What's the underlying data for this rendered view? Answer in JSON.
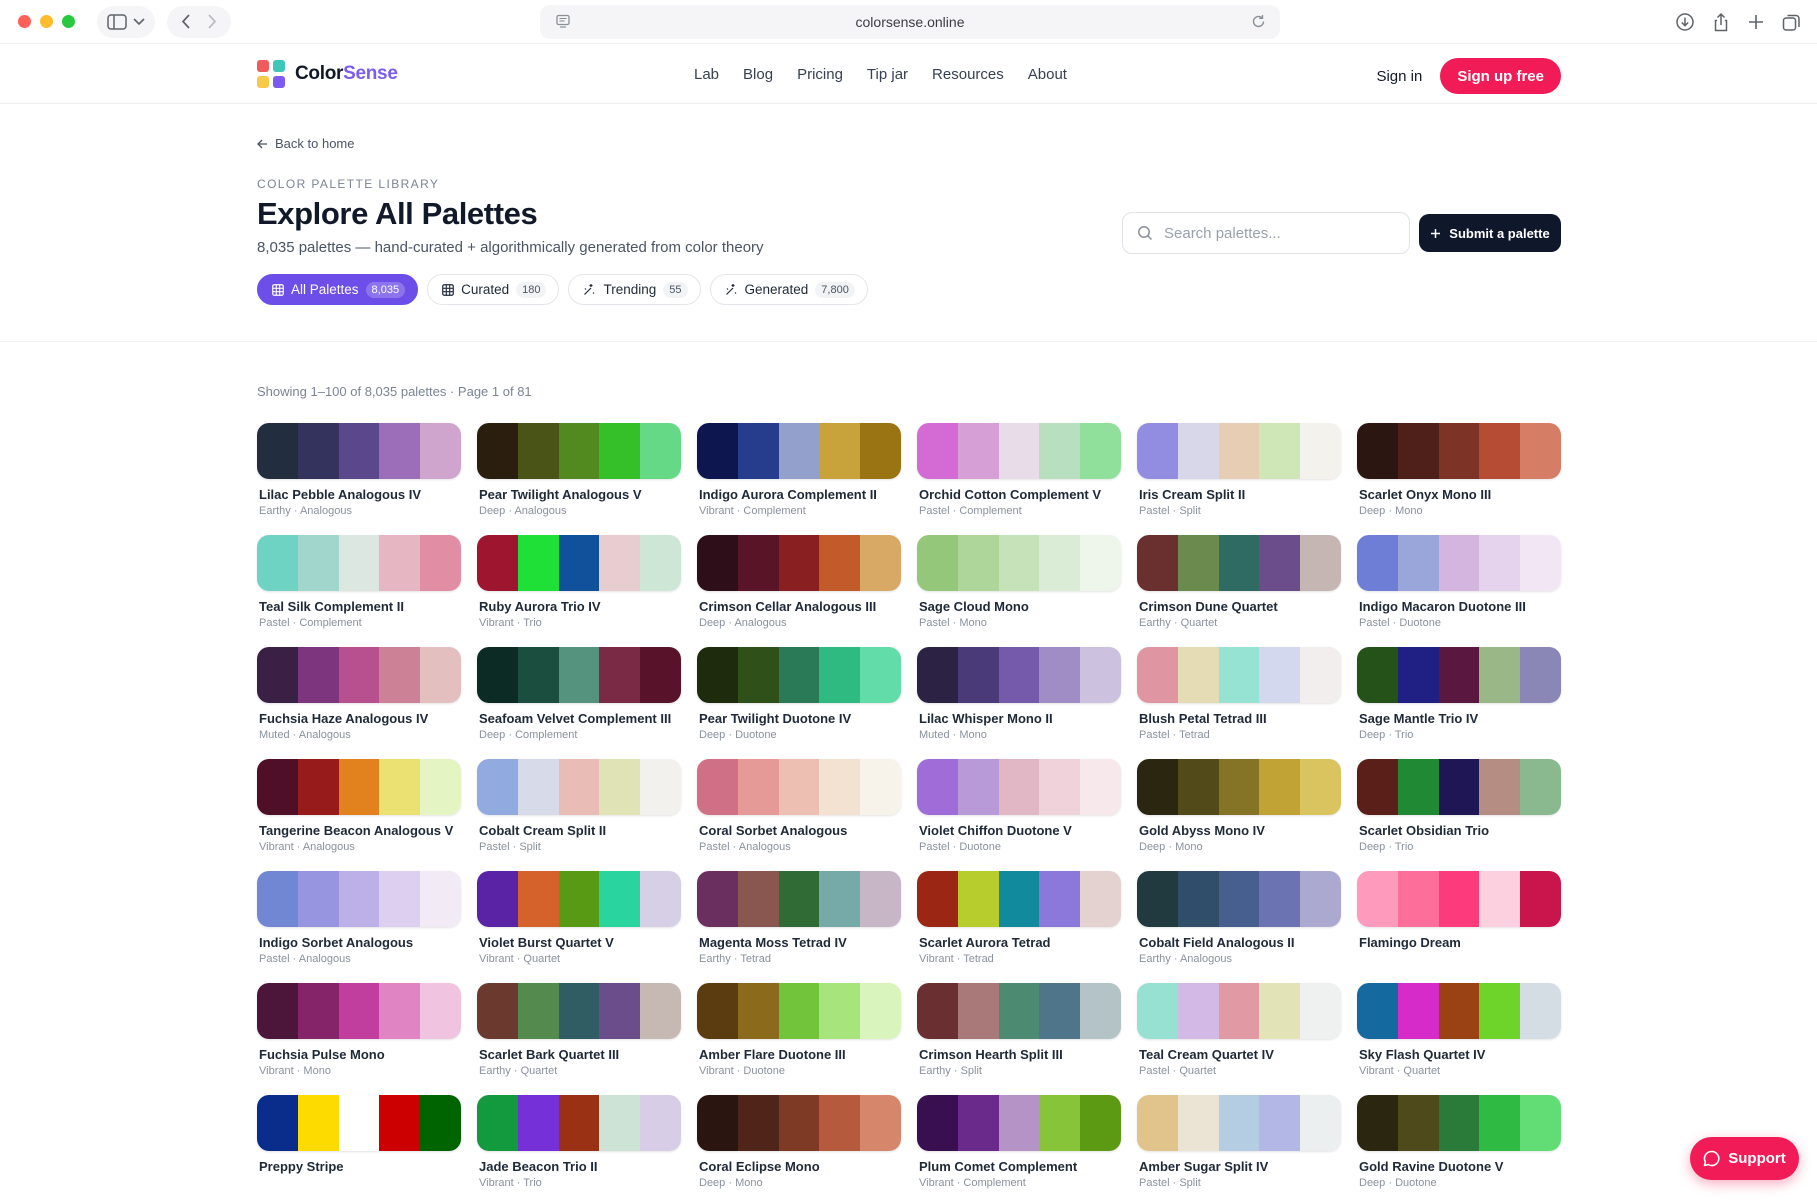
{
  "browser": {
    "url": "colorsense.online"
  },
  "brand": {
    "name_part1": "Color",
    "name_part2": "Sense",
    "logo_colors": [
      "#f25b5b",
      "#3ec6b8",
      "#f7c948",
      "#7c5cf0"
    ]
  },
  "nav": {
    "items": [
      "Lab",
      "Blog",
      "Pricing",
      "Tip jar",
      "Resources",
      "About"
    ],
    "signin": "Sign in",
    "signup": "Sign up free"
  },
  "hero": {
    "back": "Back to home",
    "eyebrow": "COLOR PALETTE LIBRARY",
    "title": "Explore All Palettes",
    "subtitle": "8,035 palettes — hand-curated + algorithmically generated from color theory",
    "search_placeholder": "Search palettes...",
    "submit": "Submit a palette"
  },
  "filters": [
    {
      "label": "All Palettes",
      "count": "8,035",
      "icon": "grid-icon",
      "active": true
    },
    {
      "label": "Curated",
      "count": "180",
      "icon": "grid-icon",
      "active": false
    },
    {
      "label": "Trending",
      "count": "55",
      "icon": "sparkle-icon",
      "active": false
    },
    {
      "label": "Generated",
      "count": "7,800",
      "icon": "sparkle-icon",
      "active": false
    }
  ],
  "results": "Showing 1–100 of 8,035 palettes · Page 1 of 81",
  "palettes": [
    {
      "name": "Lilac Pebble Analogous IV",
      "meta": "Earthy · Analogous",
      "colors": [
        "#222d3d",
        "#33335e",
        "#5b478c",
        "#9c6db8",
        "#d0a5cd"
      ]
    },
    {
      "name": "Pear Twilight Analogous V",
      "meta": "Deep · Analogous",
      "colors": [
        "#2a1f0f",
        "#4a5416",
        "#528a1f",
        "#35c02a",
        "#66d987"
      ]
    },
    {
      "name": "Indigo Aurora Complement II",
      "meta": "Vibrant · Complement",
      "colors": [
        "#0e1650",
        "#263c8c",
        "#94a0cc",
        "#c8a23a",
        "#9a7412"
      ]
    },
    {
      "name": "Orchid Cotton Complement V",
      "meta": "Pastel · Complement",
      "colors": [
        "#d46ad4",
        "#d6a0d6",
        "#e9dce9",
        "#b7dfc0",
        "#90e09c"
      ]
    },
    {
      "name": "Iris Cream Split II",
      "meta": "Pastel · Split",
      "colors": [
        "#928de0",
        "#d8d7ea",
        "#e7cdb4",
        "#cfe7b6",
        "#f3f2ec"
      ]
    },
    {
      "name": "Scarlet Onyx Mono III",
      "meta": "Deep · Mono",
      "colors": [
        "#2b1611",
        "#4e2019",
        "#7d3325",
        "#b74c35",
        "#d67d66"
      ]
    },
    {
      "name": "Teal Silk Complement II",
      "meta": "Pastel · Complement",
      "colors": [
        "#6ed3c3",
        "#a0d6cc",
        "#dce7e2",
        "#e7b6c3",
        "#e18ea4"
      ]
    },
    {
      "name": "Ruby Aurora Trio IV",
      "meta": "Vibrant · Trio",
      "colors": [
        "#9e1530",
        "#1fe037",
        "#11509a",
        "#e7ccd0",
        "#cde6d6"
      ]
    },
    {
      "name": "Crimson Cellar Analogous III",
      "meta": "Deep · Analogous",
      "colors": [
        "#2d0e19",
        "#5a1428",
        "#8a1f21",
        "#c35a2a",
        "#d8a865"
      ]
    },
    {
      "name": "Sage Cloud Mono",
      "meta": "Pastel · Mono",
      "colors": [
        "#95c77a",
        "#aed59a",
        "#c6e2b9",
        "#dbecd6",
        "#eef6ec"
      ]
    },
    {
      "name": "Crimson Dune Quartet",
      "meta": "Earthy · Quartet",
      "colors": [
        "#6a3030",
        "#6b8a4e",
        "#2f6a63",
        "#6a4d8a",
        "#c6b6b3"
      ]
    },
    {
      "name": "Indigo Macaron Duotone III",
      "meta": "Pastel · Duotone",
      "colors": [
        "#6e7ed6",
        "#9aa6da",
        "#d4b5e0",
        "#e5d2ec",
        "#f2e6f4"
      ]
    },
    {
      "name": "Fuchsia Haze Analogous IV",
      "meta": "Muted · Analogous",
      "colors": [
        "#3b2046",
        "#7d357d",
        "#b6508f",
        "#cd8196",
        "#e4bfbf"
      ]
    },
    {
      "name": "Seafoam Velvet Complement III",
      "meta": "Deep · Complement",
      "colors": [
        "#0b2b24",
        "#1c4e40",
        "#56937e",
        "#7a2a44",
        "#581229"
      ]
    },
    {
      "name": "Pear Twilight Duotone IV",
      "meta": "Deep · Duotone",
      "colors": [
        "#1f2b0d",
        "#2f5018",
        "#2a7a58",
        "#2fba82",
        "#62ddaa"
      ]
    },
    {
      "name": "Lilac Whisper Mono II",
      "meta": "Muted · Mono",
      "colors": [
        "#2c2244",
        "#4b3a78",
        "#7559aa",
        "#a08dc6",
        "#ccc2e0"
      ]
    },
    {
      "name": "Blush Petal Tetrad III",
      "meta": "Pastel · Tetrad",
      "colors": [
        "#e095a2",
        "#e5dbb4",
        "#96e2d3",
        "#d3d8ee",
        "#f3eeee"
      ]
    },
    {
      "name": "Sage Mantle Trio IV",
      "meta": "Deep · Trio",
      "colors": [
        "#245218",
        "#1f1f84",
        "#5a1840",
        "#9ab887",
        "#8a87b6"
      ]
    },
    {
      "name": "Tangerine Beacon Analogous V",
      "meta": "Vibrant · Analogous",
      "colors": [
        "#4f0f26",
        "#981b1b",
        "#e2821f",
        "#ebe173",
        "#e4f5c3"
      ]
    },
    {
      "name": "Cobalt Cream Split II",
      "meta": "Pastel · Split",
      "colors": [
        "#91aae0",
        "#d7dbe9",
        "#e9bcb6",
        "#dfe3b6",
        "#f2f1ee"
      ]
    },
    {
      "name": "Coral Sorbet Analogous",
      "meta": "Pastel · Analogous",
      "colors": [
        "#d07086",
        "#e59a98",
        "#ecbfb2",
        "#f3e2d2",
        "#f8f3ea"
      ]
    },
    {
      "name": "Violet Chiffon Duotone V",
      "meta": "Pastel · Duotone",
      "colors": [
        "#9f6cd8",
        "#b99ad8",
        "#e1b6c5",
        "#efd2da",
        "#f7e8ec"
      ]
    },
    {
      "name": "Gold Abyss Mono IV",
      "meta": "Deep · Mono",
      "colors": [
        "#2b260f",
        "#524a18",
        "#857425",
        "#c0a334",
        "#dac460"
      ]
    },
    {
      "name": "Scarlet Obsidian Trio",
      "meta": "Deep · Trio",
      "colors": [
        "#5a1f19",
        "#1f8a33",
        "#1f1656",
        "#b68d83",
        "#8ab88f"
      ]
    },
    {
      "name": "Indigo Sorbet Analogous",
      "meta": "Pastel · Analogous",
      "colors": [
        "#7187d4",
        "#9795e0",
        "#bdb0e6",
        "#dccfef",
        "#f2eaf5"
      ]
    },
    {
      "name": "Violet Burst Quartet V",
      "meta": "Vibrant · Quartet",
      "colors": [
        "#5a22a4",
        "#d5622a",
        "#589a14",
        "#2ad49d",
        "#d6d0e6"
      ]
    },
    {
      "name": "Magenta Moss Tetrad IV",
      "meta": "Earthy · Tetrad",
      "colors": [
        "#6a2f5e",
        "#8a5650",
        "#306a34",
        "#75aaa8",
        "#c6b6c6"
      ]
    },
    {
      "name": "Scarlet Aurora Tetrad",
      "meta": "Vibrant · Tetrad",
      "colors": [
        "#9a2613",
        "#b6cd2d",
        "#128a9e",
        "#8a78db",
        "#e3d2cf"
      ]
    },
    {
      "name": "Cobalt Field Analogous II",
      "meta": "Earthy · Analogous",
      "colors": [
        "#213a3f",
        "#304d6a",
        "#465f8f",
        "#6b73b3",
        "#aba9d0"
      ]
    },
    {
      "name": "Flamingo Dream",
      "meta": "",
      "colors": [
        "#fe9bbd",
        "#fd6e9a",
        "#fc3b7c",
        "#fdd0e0",
        "#c8164d"
      ]
    },
    {
      "name": "Fuchsia Pulse Mono",
      "meta": "Vibrant · Mono",
      "colors": [
        "#4b1639",
        "#86246a",
        "#c23e9e",
        "#e084c4",
        "#f0c4e1"
      ]
    },
    {
      "name": "Scarlet Bark Quartet III",
      "meta": "Earthy · Quartet",
      "colors": [
        "#6a3a2f",
        "#558a4f",
        "#2f5d63",
        "#6a4d8a",
        "#c6b9b3"
      ]
    },
    {
      "name": "Amber Flare Duotone III",
      "meta": "Vibrant · Duotone",
      "colors": [
        "#5a3c10",
        "#8c6a1c",
        "#72c43a",
        "#a7e57c",
        "#d9f5bd"
      ]
    },
    {
      "name": "Crimson Hearth Split III",
      "meta": "Earthy · Split",
      "colors": [
        "#6a3031",
        "#a87978",
        "#4d8a72",
        "#4f758a",
        "#b4c3c5"
      ]
    },
    {
      "name": "Teal Cream Quartet IV",
      "meta": "Pastel · Quartet",
      "colors": [
        "#96e1d2",
        "#d3b9e5",
        "#e19aa4",
        "#e2e4b8",
        "#eef1ef"
      ]
    },
    {
      "name": "Sky Flash Quartet IV",
      "meta": "Vibrant · Quartet",
      "colors": [
        "#146a9e",
        "#d62ac9",
        "#9a4214",
        "#6fd42a",
        "#d3dde3"
      ]
    },
    {
      "name": "Preppy Stripe",
      "meta": "",
      "colors": [
        "#0a2d8c",
        "#fedb00",
        "#ffffff",
        "#cc0000",
        "#006400"
      ]
    },
    {
      "name": "Jade Beacon Trio II",
      "meta": "Vibrant · Trio",
      "colors": [
        "#149a3e",
        "#7630d8",
        "#9a3014",
        "#cde3d6",
        "#d8cde6"
      ]
    },
    {
      "name": "Coral Eclipse Mono",
      "meta": "Deep · Mono",
      "colors": [
        "#2a1511",
        "#4f2419",
        "#7e3a25",
        "#b55a3c",
        "#d6876b"
      ]
    },
    {
      "name": "Plum Comet Complement",
      "meta": "Vibrant · Complement",
      "colors": [
        "#3a0f4f",
        "#6a2a8c",
        "#b593c6",
        "#88c43a",
        "#5c9a14"
      ]
    },
    {
      "name": "Amber Sugar Split IV",
      "meta": "Pastel · Split",
      "colors": [
        "#e1c48c",
        "#ebe3d3",
        "#b4cde3",
        "#b3b7e6",
        "#ecefef"
      ]
    },
    {
      "name": "Gold Ravine Duotone V",
      "meta": "Deep · Duotone",
      "colors": [
        "#2a2610",
        "#4f4a1c",
        "#2a7a3a",
        "#2fba44",
        "#62dd76"
      ]
    }
  ],
  "support": "Support"
}
